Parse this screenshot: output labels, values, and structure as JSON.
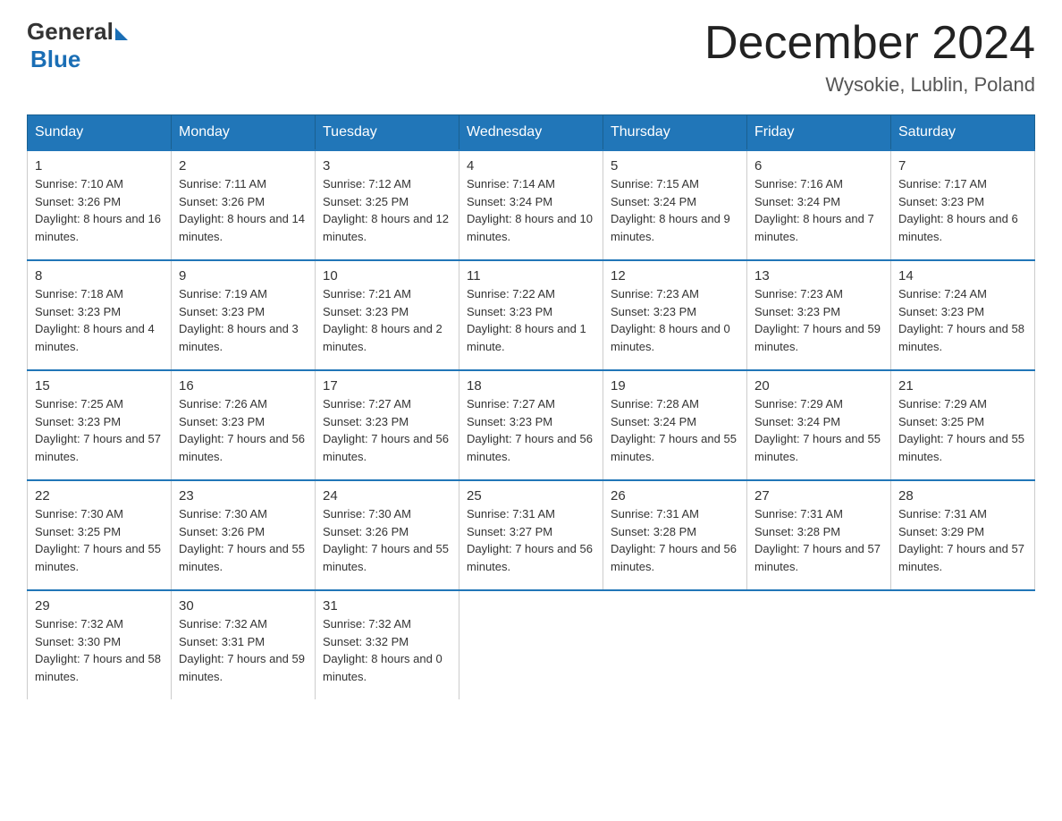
{
  "logo": {
    "general": "General",
    "blue": "Blue"
  },
  "header": {
    "title": "December 2024",
    "subtitle": "Wysokie, Lublin, Poland"
  },
  "days_of_week": [
    "Sunday",
    "Monday",
    "Tuesday",
    "Wednesday",
    "Thursday",
    "Friday",
    "Saturday"
  ],
  "weeks": [
    [
      {
        "day": "1",
        "sunrise": "7:10 AM",
        "sunset": "3:26 PM",
        "daylight": "8 hours and 16 minutes."
      },
      {
        "day": "2",
        "sunrise": "7:11 AM",
        "sunset": "3:26 PM",
        "daylight": "8 hours and 14 minutes."
      },
      {
        "day": "3",
        "sunrise": "7:12 AM",
        "sunset": "3:25 PM",
        "daylight": "8 hours and 12 minutes."
      },
      {
        "day": "4",
        "sunrise": "7:14 AM",
        "sunset": "3:24 PM",
        "daylight": "8 hours and 10 minutes."
      },
      {
        "day": "5",
        "sunrise": "7:15 AM",
        "sunset": "3:24 PM",
        "daylight": "8 hours and 9 minutes."
      },
      {
        "day": "6",
        "sunrise": "7:16 AM",
        "sunset": "3:24 PM",
        "daylight": "8 hours and 7 minutes."
      },
      {
        "day": "7",
        "sunrise": "7:17 AM",
        "sunset": "3:23 PM",
        "daylight": "8 hours and 6 minutes."
      }
    ],
    [
      {
        "day": "8",
        "sunrise": "7:18 AM",
        "sunset": "3:23 PM",
        "daylight": "8 hours and 4 minutes."
      },
      {
        "day": "9",
        "sunrise": "7:19 AM",
        "sunset": "3:23 PM",
        "daylight": "8 hours and 3 minutes."
      },
      {
        "day": "10",
        "sunrise": "7:21 AM",
        "sunset": "3:23 PM",
        "daylight": "8 hours and 2 minutes."
      },
      {
        "day": "11",
        "sunrise": "7:22 AM",
        "sunset": "3:23 PM",
        "daylight": "8 hours and 1 minute."
      },
      {
        "day": "12",
        "sunrise": "7:23 AM",
        "sunset": "3:23 PM",
        "daylight": "8 hours and 0 minutes."
      },
      {
        "day": "13",
        "sunrise": "7:23 AM",
        "sunset": "3:23 PM",
        "daylight": "7 hours and 59 minutes."
      },
      {
        "day": "14",
        "sunrise": "7:24 AM",
        "sunset": "3:23 PM",
        "daylight": "7 hours and 58 minutes."
      }
    ],
    [
      {
        "day": "15",
        "sunrise": "7:25 AM",
        "sunset": "3:23 PM",
        "daylight": "7 hours and 57 minutes."
      },
      {
        "day": "16",
        "sunrise": "7:26 AM",
        "sunset": "3:23 PM",
        "daylight": "7 hours and 56 minutes."
      },
      {
        "day": "17",
        "sunrise": "7:27 AM",
        "sunset": "3:23 PM",
        "daylight": "7 hours and 56 minutes."
      },
      {
        "day": "18",
        "sunrise": "7:27 AM",
        "sunset": "3:23 PM",
        "daylight": "7 hours and 56 minutes."
      },
      {
        "day": "19",
        "sunrise": "7:28 AM",
        "sunset": "3:24 PM",
        "daylight": "7 hours and 55 minutes."
      },
      {
        "day": "20",
        "sunrise": "7:29 AM",
        "sunset": "3:24 PM",
        "daylight": "7 hours and 55 minutes."
      },
      {
        "day": "21",
        "sunrise": "7:29 AM",
        "sunset": "3:25 PM",
        "daylight": "7 hours and 55 minutes."
      }
    ],
    [
      {
        "day": "22",
        "sunrise": "7:30 AM",
        "sunset": "3:25 PM",
        "daylight": "7 hours and 55 minutes."
      },
      {
        "day": "23",
        "sunrise": "7:30 AM",
        "sunset": "3:26 PM",
        "daylight": "7 hours and 55 minutes."
      },
      {
        "day": "24",
        "sunrise": "7:30 AM",
        "sunset": "3:26 PM",
        "daylight": "7 hours and 55 minutes."
      },
      {
        "day": "25",
        "sunrise": "7:31 AM",
        "sunset": "3:27 PM",
        "daylight": "7 hours and 56 minutes."
      },
      {
        "day": "26",
        "sunrise": "7:31 AM",
        "sunset": "3:28 PM",
        "daylight": "7 hours and 56 minutes."
      },
      {
        "day": "27",
        "sunrise": "7:31 AM",
        "sunset": "3:28 PM",
        "daylight": "7 hours and 57 minutes."
      },
      {
        "day": "28",
        "sunrise": "7:31 AM",
        "sunset": "3:29 PM",
        "daylight": "7 hours and 57 minutes."
      }
    ],
    [
      {
        "day": "29",
        "sunrise": "7:32 AM",
        "sunset": "3:30 PM",
        "daylight": "7 hours and 58 minutes."
      },
      {
        "day": "30",
        "sunrise": "7:32 AM",
        "sunset": "3:31 PM",
        "daylight": "7 hours and 59 minutes."
      },
      {
        "day": "31",
        "sunrise": "7:32 AM",
        "sunset": "3:32 PM",
        "daylight": "8 hours and 0 minutes."
      },
      null,
      null,
      null,
      null
    ]
  ],
  "labels": {
    "sunrise": "Sunrise:",
    "sunset": "Sunset:",
    "daylight": "Daylight:"
  }
}
